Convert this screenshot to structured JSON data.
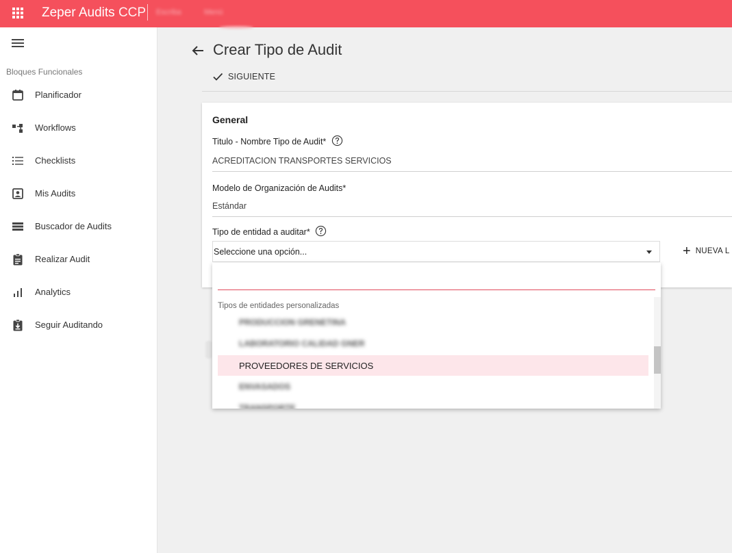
{
  "header": {
    "app_name": "Zeper Audits",
    "app_suffix": "CCP",
    "blurred_menu": [
      "Escriba",
      "Menú"
    ],
    "brand_color": "#f5505c"
  },
  "sidebar": {
    "section_title": "Bloques Funcionales",
    "items": [
      {
        "label": "Planificador",
        "icon": "calendar-icon"
      },
      {
        "label": "Workflows",
        "icon": "workflow-icon"
      },
      {
        "label": "Checklists",
        "icon": "checklist-icon"
      },
      {
        "label": "Mis Audits",
        "icon": "person-box-icon"
      },
      {
        "label": "Buscador de Audits",
        "icon": "list-view-icon"
      },
      {
        "label": "Realizar Audit",
        "icon": "clipboard-icon"
      },
      {
        "label": "Analytics",
        "icon": "bar-chart-icon"
      },
      {
        "label": "Seguir Auditando",
        "icon": "clipboard-download-icon"
      }
    ]
  },
  "page": {
    "title": "Crear Tipo de Audit",
    "next_label": "SIGUIENTE"
  },
  "form": {
    "section_title": "General",
    "titulo_label": "Titulo - Nombre Tipo de Audit*",
    "titulo_value": "ACREDITACION TRANSPORTES SERVICIOS",
    "modelo_label": "Modelo de Organización de Audits*",
    "modelo_value": "Estándar",
    "entidad_label": "Tipo de entidad a auditar*",
    "entidad_placeholder": "Seleccione una opción...",
    "nueva_label": "NUEVA L"
  },
  "dropdown": {
    "search_value": "",
    "group_label": "Tipos de entidades personalizadas",
    "options": [
      {
        "label": "PRODUCCION GRENETINA",
        "blurred": true,
        "selected": false
      },
      {
        "label": "LABORATORIO CALIDAD GNER",
        "blurred": true,
        "selected": false
      },
      {
        "label": "PROVEEDORES DE SERVICIOS",
        "blurred": false,
        "selected": true
      },
      {
        "label": "ENVASADOS",
        "blurred": true,
        "selected": false
      },
      {
        "label": "TRANSPORTE",
        "blurred": true,
        "selected": false
      }
    ],
    "highlight_color": "#fde6ea",
    "search_underline_color": "#e0495a"
  }
}
